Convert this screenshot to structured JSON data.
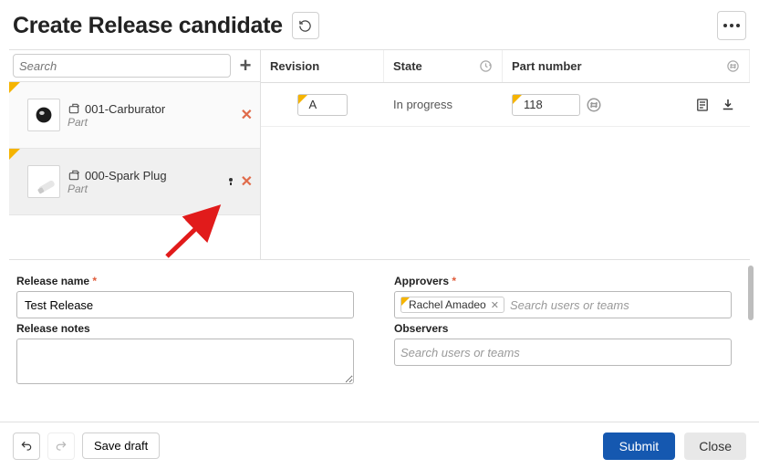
{
  "title": "Create Release candidate",
  "sidebar": {
    "search_placeholder": "Search",
    "items": [
      {
        "name": "001-Carburator",
        "type": "Part"
      },
      {
        "name": "000-Spark Plug",
        "type": "Part"
      }
    ]
  },
  "grid": {
    "headers": {
      "revision": "Revision",
      "state": "State",
      "part_number": "Part number"
    },
    "row": {
      "revision": "A",
      "state": "In progress",
      "part_number": "118"
    }
  },
  "form": {
    "release_name_label": "Release name",
    "release_name_value": "Test Release",
    "release_notes_label": "Release notes",
    "approvers_label": "Approvers",
    "approvers_chip": "Rachel Amadeo",
    "approvers_placeholder": "Search users or teams",
    "observers_label": "Observers",
    "observers_placeholder": "Search users or teams",
    "required_mark": "*"
  },
  "footer": {
    "save_draft": "Save draft",
    "submit": "Submit",
    "close": "Close"
  }
}
